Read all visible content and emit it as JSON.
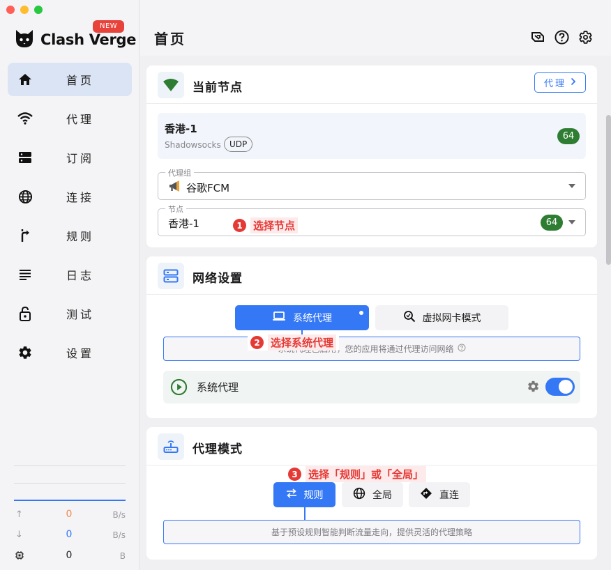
{
  "app": {
    "name": "Clash Verge",
    "badge": "NEW"
  },
  "sidebar": {
    "items": [
      {
        "label": "首页",
        "icon": "home-icon",
        "active": true
      },
      {
        "label": "代理",
        "icon": "wifi-icon"
      },
      {
        "label": "订阅",
        "icon": "server-icon"
      },
      {
        "label": "连接",
        "icon": "globe-icon"
      },
      {
        "label": "规则",
        "icon": "fork-icon"
      },
      {
        "label": "日志",
        "icon": "list-icon"
      },
      {
        "label": "测试",
        "icon": "lock-icon"
      },
      {
        "label": "设置",
        "icon": "gear-icon"
      }
    ],
    "traffic": {
      "upload": {
        "value": "0",
        "unit": "B/s",
        "color": "#f08c4f"
      },
      "download": {
        "value": "0",
        "unit": "B/s",
        "color": "#3478f6"
      },
      "memory": {
        "value": "0",
        "unit": "B"
      }
    }
  },
  "header": {
    "title": "首页"
  },
  "current_node": {
    "title": "当前节点",
    "proxy_button": "代理",
    "node": {
      "name": "香港-1",
      "type": "Shadowsocks",
      "protocol": "UDP",
      "latency": "64"
    },
    "group_select": {
      "legend": "代理组",
      "value": "谷歌FCM"
    },
    "node_select": {
      "legend": "节点",
      "value": "香港-1",
      "latency": "64"
    },
    "annotation": {
      "num": "1",
      "text": "选择节点"
    }
  },
  "network": {
    "title": "网络设置",
    "system_proxy_tab": "系统代理",
    "tun_tab": "虚拟网卡模式",
    "hint": "系统代理已启用，您的应用将通过代理访问网络",
    "annotation": {
      "num": "2",
      "text": "选择系统代理"
    },
    "row_label": "系统代理",
    "toggle_on": true
  },
  "mode": {
    "title": "代理模式",
    "annotation": {
      "num": "3",
      "text": "选择「规则」或「全局」"
    },
    "rule": "规则",
    "global": "全局",
    "direct": "直连",
    "hint": "基于预设规则智能判断流量走向，提供灵活的代理策略"
  },
  "colors": {
    "accent": "#3478f6",
    "success": "#2e7d32",
    "annotation": "#e53935"
  }
}
